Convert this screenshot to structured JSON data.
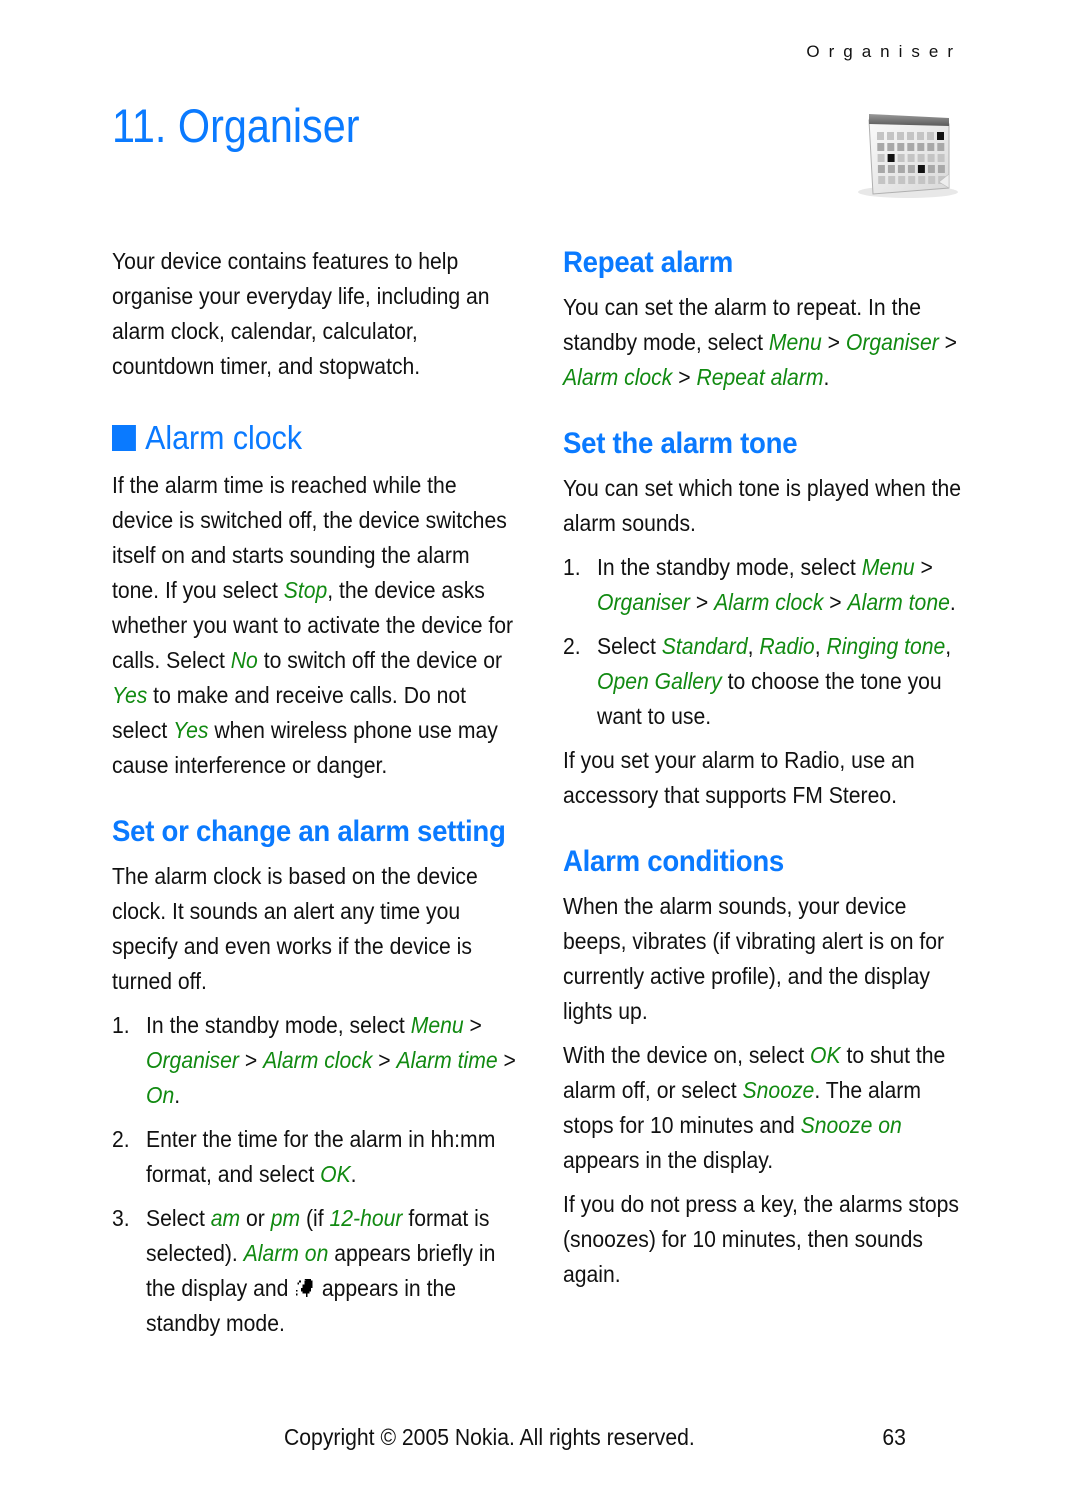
{
  "running_head": "Organiser",
  "chapter": {
    "title": "11.  Organiser",
    "icon": "calendar-icon"
  },
  "left_column": {
    "intro": "Your device contains features to help organise your everyday life, including an alarm clock, calendar, calculator, countdown timer, and stopwatch.",
    "alarm_clock": {
      "heading": "Alarm clock",
      "para": [
        {
          "t": "If the alarm time is reached while the device is switched off, the device switches itself on and starts sounding the alarm tone. If you select "
        },
        {
          "t": "Stop",
          "g": true
        },
        {
          "t": ", the device asks whether you want to activate the device for calls. Select "
        },
        {
          "t": "No",
          "g": true
        },
        {
          "t": " to switch off the device or "
        },
        {
          "t": "Yes",
          "g": true
        },
        {
          "t": " to make and receive calls. Do not select "
        },
        {
          "t": "Yes",
          "g": true
        },
        {
          "t": " when wireless phone use may cause interference or danger."
        }
      ]
    },
    "set_change": {
      "heading": "Set or change an alarm setting",
      "para": "The alarm clock is based on the device clock. It sounds an alert any time you specify and even works if the device is turned off.",
      "steps": [
        {
          "num": "1.",
          "parts": [
            {
              "t": "In the standby mode, select "
            },
            {
              "t": "Menu",
              "g": true
            },
            {
              "t": " > "
            },
            {
              "t": "Organiser",
              "g": true
            },
            {
              "t": " > "
            },
            {
              "t": "Alarm clock",
              "g": true
            },
            {
              "t": " > "
            },
            {
              "t": "Alarm time",
              "g": true
            },
            {
              "t": " > "
            },
            {
              "t": "On",
              "g": true
            },
            {
              "t": "."
            }
          ]
        },
        {
          "num": "2.",
          "parts": [
            {
              "t": "Enter the time for the alarm in hh:mm format, and select "
            },
            {
              "t": "OK",
              "g": true
            },
            {
              "t": "."
            }
          ]
        },
        {
          "num": "3.",
          "parts": [
            {
              "t": "Select "
            },
            {
              "t": "am",
              "g": true
            },
            {
              "t": " or "
            },
            {
              "t": "pm",
              "g": true
            },
            {
              "t": " (if "
            },
            {
              "t": "12-hour",
              "g": true
            },
            {
              "t": " format is selected). "
            },
            {
              "t": "Alarm on",
              "g": true
            },
            {
              "t": " appears briefly in the display and "
            },
            {
              "icon": "alarm-indicator-icon"
            },
            {
              "t": "appears in the standby mode."
            }
          ]
        }
      ]
    }
  },
  "right_column": {
    "repeat_alarm": {
      "heading": "Repeat alarm",
      "para": [
        {
          "t": "You can set the alarm to repeat. In the standby mode, select "
        },
        {
          "t": "Menu",
          "g": true
        },
        {
          "t": " > "
        },
        {
          "t": "Organiser",
          "g": true
        },
        {
          "t": " > "
        },
        {
          "t": "Alarm clock",
          "g": true
        },
        {
          "t": " > "
        },
        {
          "t": "Repeat alarm",
          "g": true
        },
        {
          "t": "."
        }
      ]
    },
    "alarm_tone": {
      "heading": "Set the alarm tone",
      "para": "You can set which tone is played when the alarm sounds.",
      "steps": [
        {
          "num": "1.",
          "parts": [
            {
              "t": "In the standby mode, select "
            },
            {
              "t": "Menu",
              "g": true
            },
            {
              "t": " > "
            },
            {
              "t": "Organiser",
              "g": true
            },
            {
              "t": " > "
            },
            {
              "t": "Alarm clock",
              "g": true
            },
            {
              "t": " > "
            },
            {
              "t": "Alarm tone",
              "g": true
            },
            {
              "t": "."
            }
          ]
        },
        {
          "num": "2.",
          "parts": [
            {
              "t": "Select "
            },
            {
              "t": "Standard",
              "g": true
            },
            {
              "t": ", "
            },
            {
              "t": "Radio",
              "g": true
            },
            {
              "t": ", "
            },
            {
              "t": "Ringing tone",
              "g": true
            },
            {
              "t": ", "
            },
            {
              "t": "Open Gallery",
              "g": true
            },
            {
              "t": " to choose the tone you want to use."
            }
          ]
        }
      ],
      "note": "If you set your alarm to Radio, use an accessory that supports FM Stereo."
    },
    "conditions": {
      "heading": "Alarm conditions",
      "para1": "When the alarm sounds, your device beeps, vibrates (if vibrating alert is on for currently active profile), and the display lights up.",
      "para2": [
        {
          "t": "With the device on, select "
        },
        {
          "t": "OK",
          "g": true
        },
        {
          "t": " to shut the alarm off, or select "
        },
        {
          "t": "Snooze",
          "g": true
        },
        {
          "t": ". The alarm stops for 10 minutes and "
        },
        {
          "t": "Snooze on",
          "g": true
        },
        {
          "t": " appears in the display."
        }
      ],
      "para3": "If you do not press a key, the alarms stops (snoozes) for 10 minutes, then sounds again."
    }
  },
  "footer": {
    "copyright": "Copyright © 2005 Nokia. All rights reserved.",
    "page_number": "63"
  },
  "colors": {
    "heading_blue": "#0a7aff",
    "menu_green": "#118a11",
    "text": "#111111"
  }
}
